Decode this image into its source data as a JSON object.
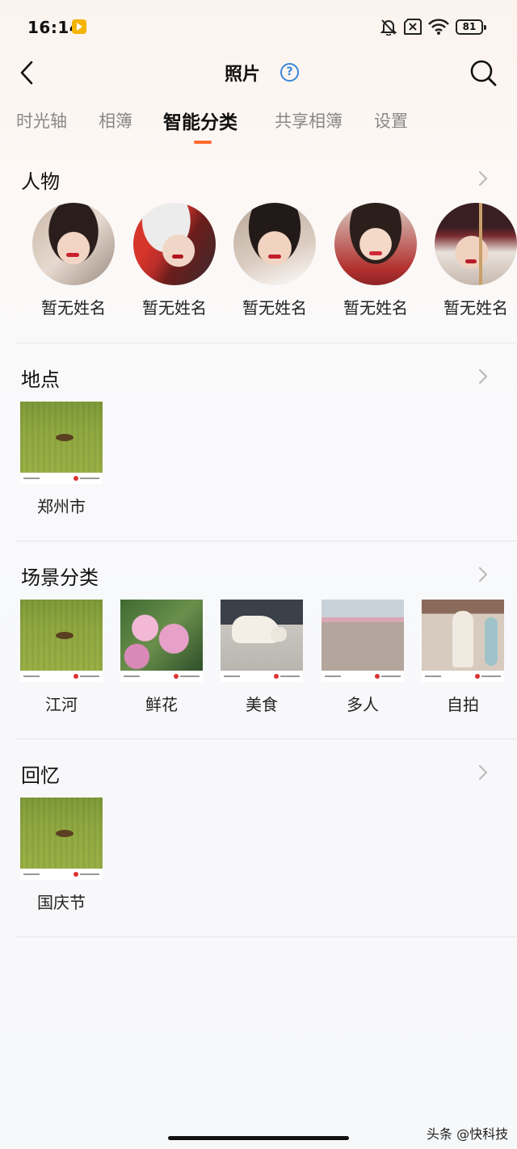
{
  "status_bar": {
    "time": "16:14",
    "battery": "81",
    "icons": [
      "app-badge-icon",
      "mute-bell-icon",
      "no-sim-icon",
      "wifi-icon",
      "battery-icon"
    ]
  },
  "header": {
    "title": "照片",
    "help_label": "?",
    "icons": [
      "back-arrow-icon",
      "help-icon",
      "search-icon"
    ]
  },
  "tabs": [
    {
      "label": "时光轴",
      "active": false
    },
    {
      "label": "相簿",
      "active": false
    },
    {
      "label": "智能分类",
      "active": true
    },
    {
      "label": "共享相簿",
      "active": false
    },
    {
      "label": "设置",
      "active": false
    }
  ],
  "accent_color": "#ff6a2b",
  "sections": {
    "people": {
      "title": "人物",
      "items": [
        {
          "label": "暂无姓名"
        },
        {
          "label": "暂无姓名"
        },
        {
          "label": "暂无姓名"
        },
        {
          "label": "暂无姓名"
        },
        {
          "label": "暂无姓名"
        }
      ]
    },
    "places": {
      "title": "地点",
      "items": [
        {
          "label": "郑州市"
        }
      ]
    },
    "scenes": {
      "title": "场景分类",
      "items": [
        {
          "label": "江河"
        },
        {
          "label": "鲜花"
        },
        {
          "label": "美食"
        },
        {
          "label": "多人"
        },
        {
          "label": "自拍"
        }
      ]
    },
    "memories": {
      "title": "回忆",
      "items": [
        {
          "label": "国庆节"
        }
      ]
    }
  },
  "watermark": "头条 @快科技"
}
